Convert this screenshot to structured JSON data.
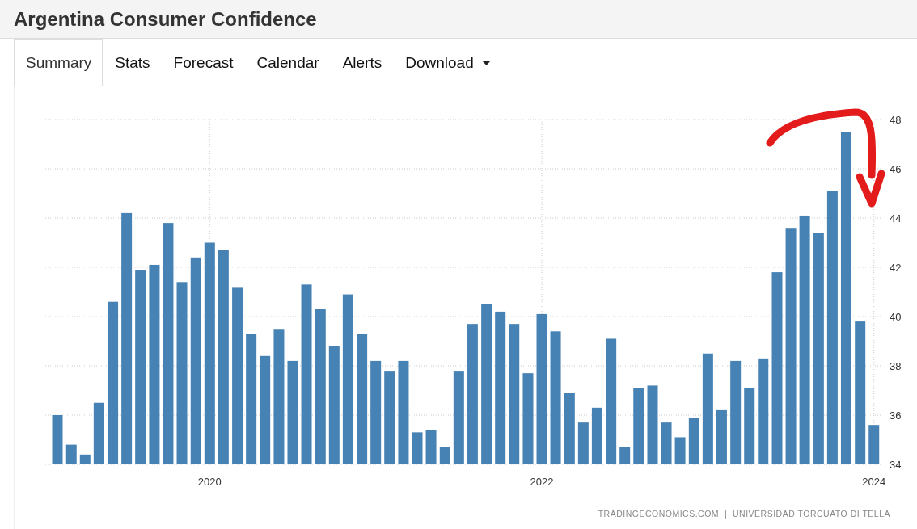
{
  "page": {
    "title": "Argentina Consumer Confidence"
  },
  "tabs": [
    {
      "label": "Summary",
      "selected": true,
      "dropdown": false
    },
    {
      "label": "Stats",
      "selected": false,
      "dropdown": false
    },
    {
      "label": "Forecast",
      "selected": false,
      "dropdown": false
    },
    {
      "label": "Calendar",
      "selected": false,
      "dropdown": false
    },
    {
      "label": "Alerts",
      "selected": false,
      "dropdown": false
    },
    {
      "label": "Download",
      "selected": false,
      "dropdown": true
    }
  ],
  "chart": {
    "chart_data": {
      "type": "bar",
      "x": [
        2019.083,
        2019.167,
        2019.25,
        2019.333,
        2019.417,
        2019.5,
        2019.583,
        2019.667,
        2019.75,
        2019.833,
        2019.917,
        2020.0,
        2020.083,
        2020.167,
        2020.25,
        2020.333,
        2020.417,
        2020.5,
        2020.583,
        2020.667,
        2020.75,
        2020.833,
        2020.917,
        2021.0,
        2021.083,
        2021.167,
        2021.25,
        2021.333,
        2021.417,
        2021.5,
        2021.583,
        2021.667,
        2021.75,
        2021.833,
        2021.917,
        2022.0,
        2022.083,
        2022.167,
        2022.25,
        2022.333,
        2022.417,
        2022.5,
        2022.583,
        2022.667,
        2022.75,
        2022.833,
        2022.917,
        2023.0,
        2023.083,
        2023.167,
        2023.25,
        2023.333,
        2023.417,
        2023.5,
        2023.583,
        2023.667,
        2023.75,
        2023.833,
        2023.917,
        2024.0
      ],
      "values": [
        36.0,
        34.8,
        34.4,
        36.5,
        40.6,
        44.2,
        41.9,
        42.1,
        43.8,
        41.4,
        42.4,
        43.0,
        42.7,
        41.2,
        39.3,
        38.4,
        39.5,
        38.2,
        41.3,
        40.3,
        38.8,
        40.9,
        39.3,
        38.2,
        37.8,
        38.2,
        35.3,
        35.4,
        34.7,
        37.8,
        39.7,
        40.5,
        40.2,
        39.7,
        37.7,
        40.1,
        39.4,
        36.9,
        35.7,
        36.3,
        39.1,
        34.7,
        37.1,
        37.2,
        35.7,
        35.1,
        35.9,
        38.5,
        36.2,
        38.2,
        37.1,
        38.3,
        41.8,
        43.6,
        44.1,
        43.4,
        45.1,
        47.5,
        39.8,
        35.6
      ],
      "xlim": [
        2019.01,
        2024.05
      ],
      "ylim": [
        34,
        48
      ],
      "yticks": [
        34,
        36,
        38,
        40,
        42,
        44,
        46,
        48
      ],
      "xticks": [
        2020,
        2022,
        2024
      ],
      "grid": true
    },
    "credit": "TRADINGECONOMICS.COM  |  UNIVERSIDAD TORCUATO DI TELLA"
  }
}
